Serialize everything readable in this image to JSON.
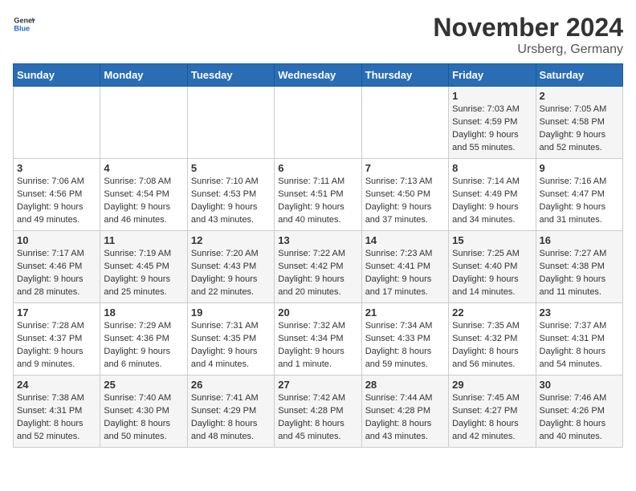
{
  "header": {
    "logo_general": "General",
    "logo_blue": "Blue",
    "month_title": "November 2024",
    "location": "Ursberg, Germany"
  },
  "weekdays": [
    "Sunday",
    "Monday",
    "Tuesday",
    "Wednesday",
    "Thursday",
    "Friday",
    "Saturday"
  ],
  "weeks": [
    [
      {
        "day": "",
        "info": ""
      },
      {
        "day": "",
        "info": ""
      },
      {
        "day": "",
        "info": ""
      },
      {
        "day": "",
        "info": ""
      },
      {
        "day": "",
        "info": ""
      },
      {
        "day": "1",
        "info": "Sunrise: 7:03 AM\nSunset: 4:59 PM\nDaylight: 9 hours and 55 minutes."
      },
      {
        "day": "2",
        "info": "Sunrise: 7:05 AM\nSunset: 4:58 PM\nDaylight: 9 hours and 52 minutes."
      }
    ],
    [
      {
        "day": "3",
        "info": "Sunrise: 7:06 AM\nSunset: 4:56 PM\nDaylight: 9 hours and 49 minutes."
      },
      {
        "day": "4",
        "info": "Sunrise: 7:08 AM\nSunset: 4:54 PM\nDaylight: 9 hours and 46 minutes."
      },
      {
        "day": "5",
        "info": "Sunrise: 7:10 AM\nSunset: 4:53 PM\nDaylight: 9 hours and 43 minutes."
      },
      {
        "day": "6",
        "info": "Sunrise: 7:11 AM\nSunset: 4:51 PM\nDaylight: 9 hours and 40 minutes."
      },
      {
        "day": "7",
        "info": "Sunrise: 7:13 AM\nSunset: 4:50 PM\nDaylight: 9 hours and 37 minutes."
      },
      {
        "day": "8",
        "info": "Sunrise: 7:14 AM\nSunset: 4:49 PM\nDaylight: 9 hours and 34 minutes."
      },
      {
        "day": "9",
        "info": "Sunrise: 7:16 AM\nSunset: 4:47 PM\nDaylight: 9 hours and 31 minutes."
      }
    ],
    [
      {
        "day": "10",
        "info": "Sunrise: 7:17 AM\nSunset: 4:46 PM\nDaylight: 9 hours and 28 minutes."
      },
      {
        "day": "11",
        "info": "Sunrise: 7:19 AM\nSunset: 4:45 PM\nDaylight: 9 hours and 25 minutes."
      },
      {
        "day": "12",
        "info": "Sunrise: 7:20 AM\nSunset: 4:43 PM\nDaylight: 9 hours and 22 minutes."
      },
      {
        "day": "13",
        "info": "Sunrise: 7:22 AM\nSunset: 4:42 PM\nDaylight: 9 hours and 20 minutes."
      },
      {
        "day": "14",
        "info": "Sunrise: 7:23 AM\nSunset: 4:41 PM\nDaylight: 9 hours and 17 minutes."
      },
      {
        "day": "15",
        "info": "Sunrise: 7:25 AM\nSunset: 4:40 PM\nDaylight: 9 hours and 14 minutes."
      },
      {
        "day": "16",
        "info": "Sunrise: 7:27 AM\nSunset: 4:38 PM\nDaylight: 9 hours and 11 minutes."
      }
    ],
    [
      {
        "day": "17",
        "info": "Sunrise: 7:28 AM\nSunset: 4:37 PM\nDaylight: 9 hours and 9 minutes."
      },
      {
        "day": "18",
        "info": "Sunrise: 7:29 AM\nSunset: 4:36 PM\nDaylight: 9 hours and 6 minutes."
      },
      {
        "day": "19",
        "info": "Sunrise: 7:31 AM\nSunset: 4:35 PM\nDaylight: 9 hours and 4 minutes."
      },
      {
        "day": "20",
        "info": "Sunrise: 7:32 AM\nSunset: 4:34 PM\nDaylight: 9 hours and 1 minute."
      },
      {
        "day": "21",
        "info": "Sunrise: 7:34 AM\nSunset: 4:33 PM\nDaylight: 8 hours and 59 minutes."
      },
      {
        "day": "22",
        "info": "Sunrise: 7:35 AM\nSunset: 4:32 PM\nDaylight: 8 hours and 56 minutes."
      },
      {
        "day": "23",
        "info": "Sunrise: 7:37 AM\nSunset: 4:31 PM\nDaylight: 8 hours and 54 minutes."
      }
    ],
    [
      {
        "day": "24",
        "info": "Sunrise: 7:38 AM\nSunset: 4:31 PM\nDaylight: 8 hours and 52 minutes."
      },
      {
        "day": "25",
        "info": "Sunrise: 7:40 AM\nSunset: 4:30 PM\nDaylight: 8 hours and 50 minutes."
      },
      {
        "day": "26",
        "info": "Sunrise: 7:41 AM\nSunset: 4:29 PM\nDaylight: 8 hours and 48 minutes."
      },
      {
        "day": "27",
        "info": "Sunrise: 7:42 AM\nSunset: 4:28 PM\nDaylight: 8 hours and 45 minutes."
      },
      {
        "day": "28",
        "info": "Sunrise: 7:44 AM\nSunset: 4:28 PM\nDaylight: 8 hours and 43 minutes."
      },
      {
        "day": "29",
        "info": "Sunrise: 7:45 AM\nSunset: 4:27 PM\nDaylight: 8 hours and 42 minutes."
      },
      {
        "day": "30",
        "info": "Sunrise: 7:46 AM\nSunset: 4:26 PM\nDaylight: 8 hours and 40 minutes."
      }
    ]
  ]
}
